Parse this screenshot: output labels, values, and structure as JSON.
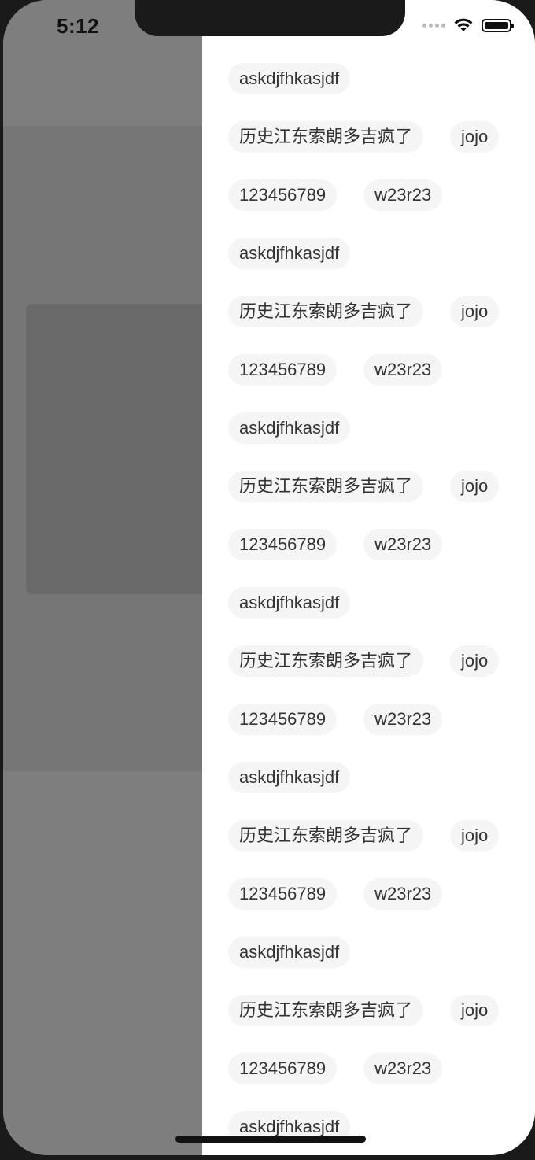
{
  "status_bar": {
    "time": "5:12",
    "wifi_icon": "wifi-icon",
    "battery_icon": "battery-icon"
  },
  "drawer": {
    "rows": [
      [
        "askdjfhkasjdf"
      ],
      [
        "历史江东索朗多吉疯了",
        "jojo"
      ],
      [
        "123456789",
        "w23r23"
      ],
      [
        "askdjfhkasjdf"
      ],
      [
        "历史江东索朗多吉疯了",
        "jojo"
      ],
      [
        "123456789",
        "w23r23"
      ],
      [
        "askdjfhkasjdf"
      ],
      [
        "历史江东索朗多吉疯了",
        "jojo"
      ],
      [
        "123456789",
        "w23r23"
      ],
      [
        "askdjfhkasjdf"
      ],
      [
        "历史江东索朗多吉疯了",
        "jojo"
      ],
      [
        "123456789",
        "w23r23"
      ],
      [
        "askdjfhkasjdf"
      ],
      [
        "历史江东索朗多吉疯了",
        "jojo"
      ],
      [
        "123456789",
        "w23r23"
      ],
      [
        "askdjfhkasjdf"
      ],
      [
        "历史江东索朗多吉疯了",
        "jojo"
      ],
      [
        "123456789",
        "w23r23"
      ],
      [
        "askdjfhkasjdf"
      ]
    ]
  },
  "colors": {
    "tag_bg": "#f5f5f5",
    "tag_text": "#333333",
    "overlay": "#808080"
  }
}
